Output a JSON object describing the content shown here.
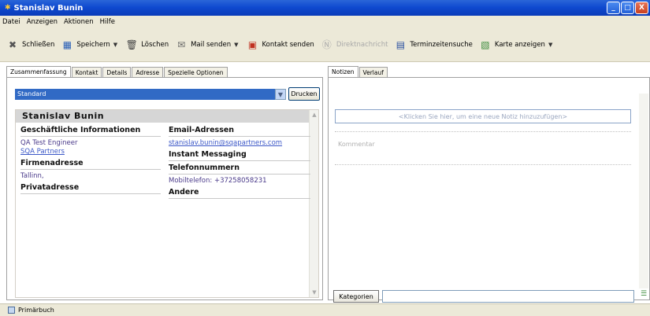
{
  "window": {
    "title": "Stanislav Bunin",
    "buttons": [
      "_",
      "□",
      "X"
    ]
  },
  "menu": [
    "Datei",
    "Anzeigen",
    "Aktionen",
    "Hilfe"
  ],
  "toolbar": {
    "close": "Schließen",
    "save": "Speichern",
    "delete": "Löschen",
    "mail": "Mail senden",
    "contact_send": "Kontakt senden",
    "direct": "Direktnachricht",
    "dates": "Terminzeitensuche",
    "map": "Karte anzeigen",
    "dropdown": "▼"
  },
  "left_tabs": [
    "Zusammenfassung",
    "Kontakt",
    "Details",
    "Adresse",
    "Spezielle Optionen"
  ],
  "right_tabs": [
    "Notizen",
    "Verlauf"
  ],
  "view": {
    "selected": "Standard",
    "print": "Drucken"
  },
  "card": {
    "name": "Stanislav Bunin",
    "business": {
      "heading": "Geschäftliche Informationen",
      "title": "QA Test Engineer",
      "company": "SQA Partners"
    },
    "company_address": {
      "heading": "Firmenadresse",
      "city": "Tallinn,"
    },
    "private_address": {
      "heading": "Privatadresse"
    },
    "email": {
      "heading": "Email-Adressen",
      "address": "stanislav.bunin@sqapartners.com"
    },
    "im": {
      "heading": "Instant Messaging"
    },
    "phones": {
      "heading": "Telefonnummern",
      "mobile_label": "Mobiltelefon:",
      "mobile": "+37258058231"
    },
    "other": {
      "heading": "Andere"
    }
  },
  "notes": {
    "placeholder": "<Klicken Sie hier, um eine neue Notiz hinzuzufügen>",
    "comment": "Kommentar",
    "categories": "Kategorien"
  },
  "status": {
    "book": "Primärbuch"
  }
}
